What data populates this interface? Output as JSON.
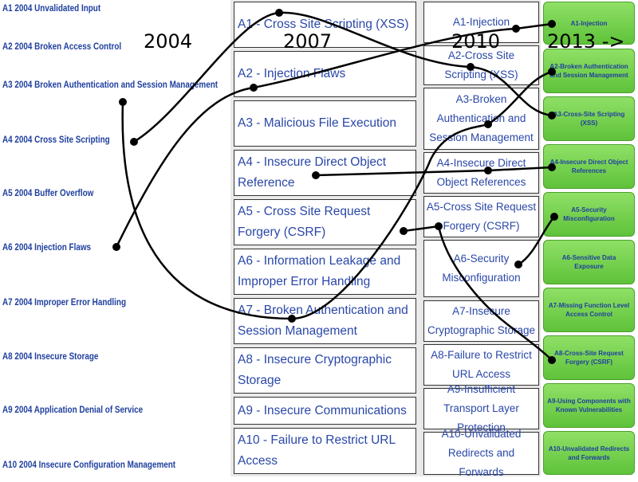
{
  "years": [
    "2004",
    "2007",
    "2010",
    "2013 ->"
  ],
  "list2004": [
    "A1 2004 Unvalidated Input",
    "A2 2004 Broken Access Control",
    "A3 2004 Broken Authentication and Session Management",
    "A4 2004 Cross Site Scripting",
    "A5 2004 Buffer Overflow",
    "A6 2004 Injection Flaws",
    "A7 2004 Improper Error Handling",
    "A8 2004 Insecure Storage",
    "A9 2004 Application Denial of Service",
    "A10 2004 Insecure Configuration Management"
  ],
  "list2007": [
    "A1 - Cross Site Scripting (XSS)",
    "A2 - Injection Flaws",
    "A3 - Malicious File Execution",
    "A4 - Insecure Direct Object Reference",
    "A5 - Cross Site Request Forgery (CSRF)",
    "A6 - Information Leakage and Improper Error Handling",
    "A7 - Broken Authentication and Session Management",
    "A8 - Insecure Cryptographic Storage",
    "A9 - Insecure Communications",
    "A10 - Failure to Restrict URL Access"
  ],
  "list2010": [
    "A1-Injection",
    "A2-Cross Site Scripting (XSS)",
    "A3-Broken Authentication and Session Management",
    "A4-Insecure Direct Object References",
    "A5-Cross Site Request Forgery (CSRF)",
    "A6-Security Misconfiguration",
    "A7-Insecure Cryptographic Storage",
    "A8-Failure to Restrict URL Access",
    "A9-Insufficient Transport Layer Protection",
    "A10-Unvalidated Redirects and Forwards"
  ],
  "list2013": [
    "A1-Injection",
    "A2-Broken Authentication and Session Management",
    "A3-Cross-Site Scripting (XSS)",
    "A4-Insecure Direct Object References",
    "A5-Security Misconfiguration",
    "A6-Sensitive Data Exposure",
    "A7-Missing Function Level Access Control",
    "A8-Cross-Site Request Forgery (CSRF)",
    "A9-Using Components with Known Vulnerabilities",
    "A10-Unvalidated Redirects and Forwards"
  ]
}
